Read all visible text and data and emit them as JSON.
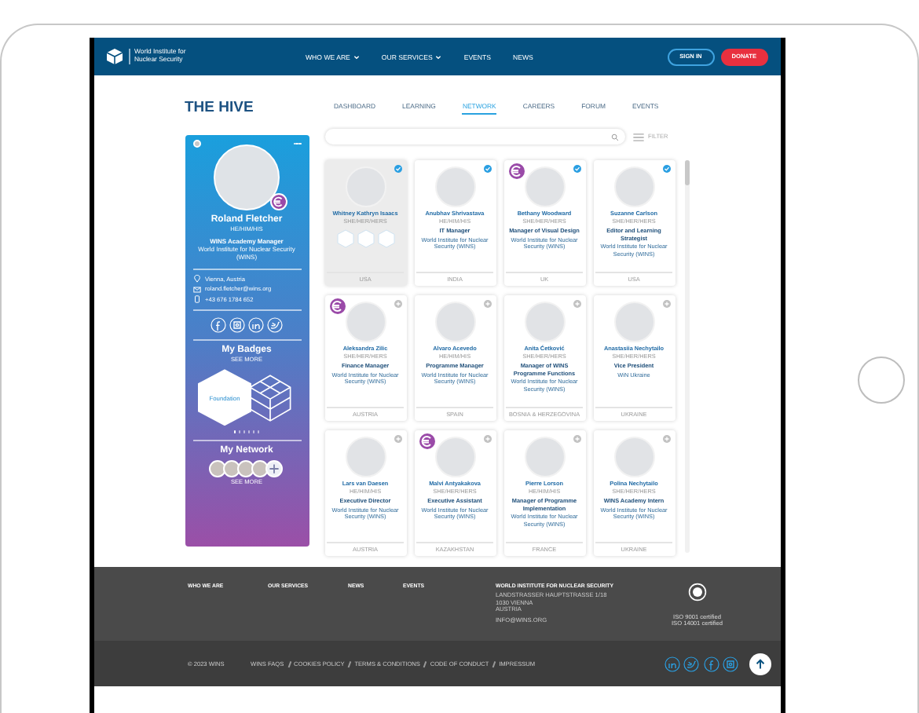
{
  "header": {
    "logo_text": [
      "World Institute for",
      "Nuclear Security"
    ],
    "nav": [
      {
        "label": "WHO WE ARE",
        "dropdown": true
      },
      {
        "label": "OUR SERVICES",
        "dropdown": true
      },
      {
        "label": "EVENTS",
        "dropdown": false
      },
      {
        "label": "NEWS",
        "dropdown": false
      }
    ],
    "sign_in": "SIGN IN",
    "donate": "DONATE"
  },
  "page_title": "THE HIVE",
  "tabs": [
    {
      "label": "DASHBOARD",
      "selected": false
    },
    {
      "label": "LEARNING",
      "selected": false
    },
    {
      "label": "NETWORK",
      "selected": true
    },
    {
      "label": "CAREERS",
      "selected": false
    },
    {
      "label": "FORUM",
      "selected": false
    },
    {
      "label": "EVENTS",
      "selected": false
    }
  ],
  "profile": {
    "name": "Roland Fletcher",
    "pronouns": "HE/HIM/HIS",
    "role": "WINS Academy Manager",
    "org": "World Institute for Nuclear Security (WINS)",
    "verified_badge": true,
    "contacts": [
      {
        "kind": "location",
        "text": "Vienna, Austria"
      },
      {
        "kind": "email",
        "text": "roland.fletcher@wins.org"
      },
      {
        "kind": "phone",
        "text": "+43 676 1784 652"
      }
    ],
    "socials": [
      {
        "kind": "facebook"
      },
      {
        "kind": "instagram"
      },
      {
        "kind": "linkedin"
      },
      {
        "kind": "twitter"
      }
    ],
    "badges_title": "My Badges",
    "badges_more": "SEE MORE",
    "badge_label": "Foundation",
    "slides": [
      {
        "selected": true
      },
      {
        "selected": false
      },
      {
        "selected": false
      },
      {
        "selected": false
      },
      {
        "selected": false
      },
      {
        "selected": false
      }
    ],
    "network_title": "My Network",
    "network_more": "SEE MORE",
    "network_avatars": [
      {
        "kind": "photo"
      },
      {
        "kind": "photo"
      },
      {
        "kind": "photo"
      },
      {
        "kind": "photo"
      }
    ]
  },
  "search": {
    "filter": "FILTER"
  },
  "people": [
    {
      "name": "Whitney Kathryn Isaacs",
      "pronouns": "SHE/HER/HERS",
      "country": "USA",
      "connected": true,
      "euro": false,
      "selected": true,
      "show_badges": true
    },
    {
      "name": "Anubhav Shrivastava",
      "pronouns": "HE/HIM/HIS",
      "title": "IT Manager",
      "org": "World Institute for Nuclear Security (WINS)",
      "country": "INDIA",
      "connected": true,
      "euro": false,
      "selected": false,
      "show_badges": false
    },
    {
      "name": "Bethany Woodward",
      "pronouns": "SHE/HER/HERS",
      "title": "Manager of Visual Design",
      "org": "World Institute for Nuclear Security (WINS)",
      "country": "UK",
      "connected": true,
      "euro": true,
      "selected": false,
      "show_badges": false
    },
    {
      "name": "Suzanne Carlson",
      "pronouns": "SHE/HER/HERS",
      "title": "Editor and Learning Strategist",
      "org": "World Institute for Nuclear Security (WINS)",
      "country": "USA",
      "connected": true,
      "euro": false,
      "selected": false,
      "show_badges": false
    },
    {
      "name": "Aleksandra Zilic",
      "pronouns": "SHE/HER/HERS",
      "title": "Finance Manager",
      "org": "World Institute for Nuclear Security (WINS)",
      "country": "AUSTRIA",
      "connected": false,
      "euro": true,
      "selected": false,
      "show_badges": false
    },
    {
      "name": "Alvaro Acevedo",
      "pronouns": "HE/HIM/HIS",
      "title": "Programme Manager",
      "org": "World Institute for Nuclear Security (WINS)",
      "country": "SPAIN",
      "connected": false,
      "euro": false,
      "selected": false,
      "show_badges": false
    },
    {
      "name": "Anita Ćetković",
      "pronouns": "SHE/HER/HERS",
      "title": "Manager of WINS Programme Functions",
      "org": "World Institute for Nuclear Security (WINS)",
      "country": "BOSNIA & HERZEGOVINA",
      "connected": false,
      "euro": false,
      "selected": false,
      "show_badges": false
    },
    {
      "name": "Anastasiia Nechytailo",
      "pronouns": "SHE/HER/HERS",
      "title": "Vice President",
      "org": "WiN Ukraine",
      "country": "UKRAINE",
      "connected": false,
      "euro": false,
      "selected": false,
      "show_badges": false
    },
    {
      "name": "Lars van Daesen",
      "pronouns": "HE/HIM/HIS",
      "title": "Executive Director",
      "org": "World Institute for Nuclear Security (WINS)",
      "country": "AUSTRIA",
      "connected": false,
      "euro": false,
      "selected": false,
      "show_badges": false
    },
    {
      "name": "Malvi Antyakakova",
      "pronouns": "SHE/HER/HERS",
      "title": "Executive Assistant",
      "org": "World Institute for Nuclear Security (WINS)",
      "country": "KAZAKHSTAN",
      "connected": false,
      "euro": true,
      "selected": false,
      "show_badges": false
    },
    {
      "name": "Pierre Lorson",
      "pronouns": "HE/HIM/HIS",
      "title": "Manager of Programme Implementation",
      "org": "World Institute for Nuclear Security (WINS)",
      "country": "FRANCE",
      "connected": false,
      "euro": false,
      "selected": false,
      "show_badges": false
    },
    {
      "name": "Polina Nechytailo",
      "pronouns": "SHE/HER/HERS",
      "title": "WINS Academy Intern",
      "org": "World Institute for Nuclear Security (WINS)",
      "country": "UKRAINE",
      "connected": false,
      "euro": false,
      "selected": false,
      "show_badges": false
    }
  ],
  "footer": {
    "columns": [
      "WHO WE ARE",
      "OUR SERVICES",
      "NEWS",
      "EVENTS"
    ],
    "address_title": "WORLD INSTITUTE FOR NUCLEAR SECURITY",
    "address": [
      "LANDSTRASSER HAUPTSTRASSE 1/18",
      "1030 VIENNA",
      "AUSTRIA"
    ],
    "email": "INFO@WINS.ORG",
    "cert_lines": [
      "ISO 9001 certified",
      "ISO 14001 certified"
    ],
    "copyright": "© 2023 WINS",
    "links": [
      "WINS FAQS",
      "COOKIES POLICY",
      "TERMS & CONDITIONS",
      "CODE OF CONDUCT",
      "IMPRESSUM"
    ],
    "socials": [
      {
        "kind": "linkedin"
      },
      {
        "kind": "twitter"
      },
      {
        "kind": "facebook"
      },
      {
        "kind": "instagram"
      }
    ]
  }
}
